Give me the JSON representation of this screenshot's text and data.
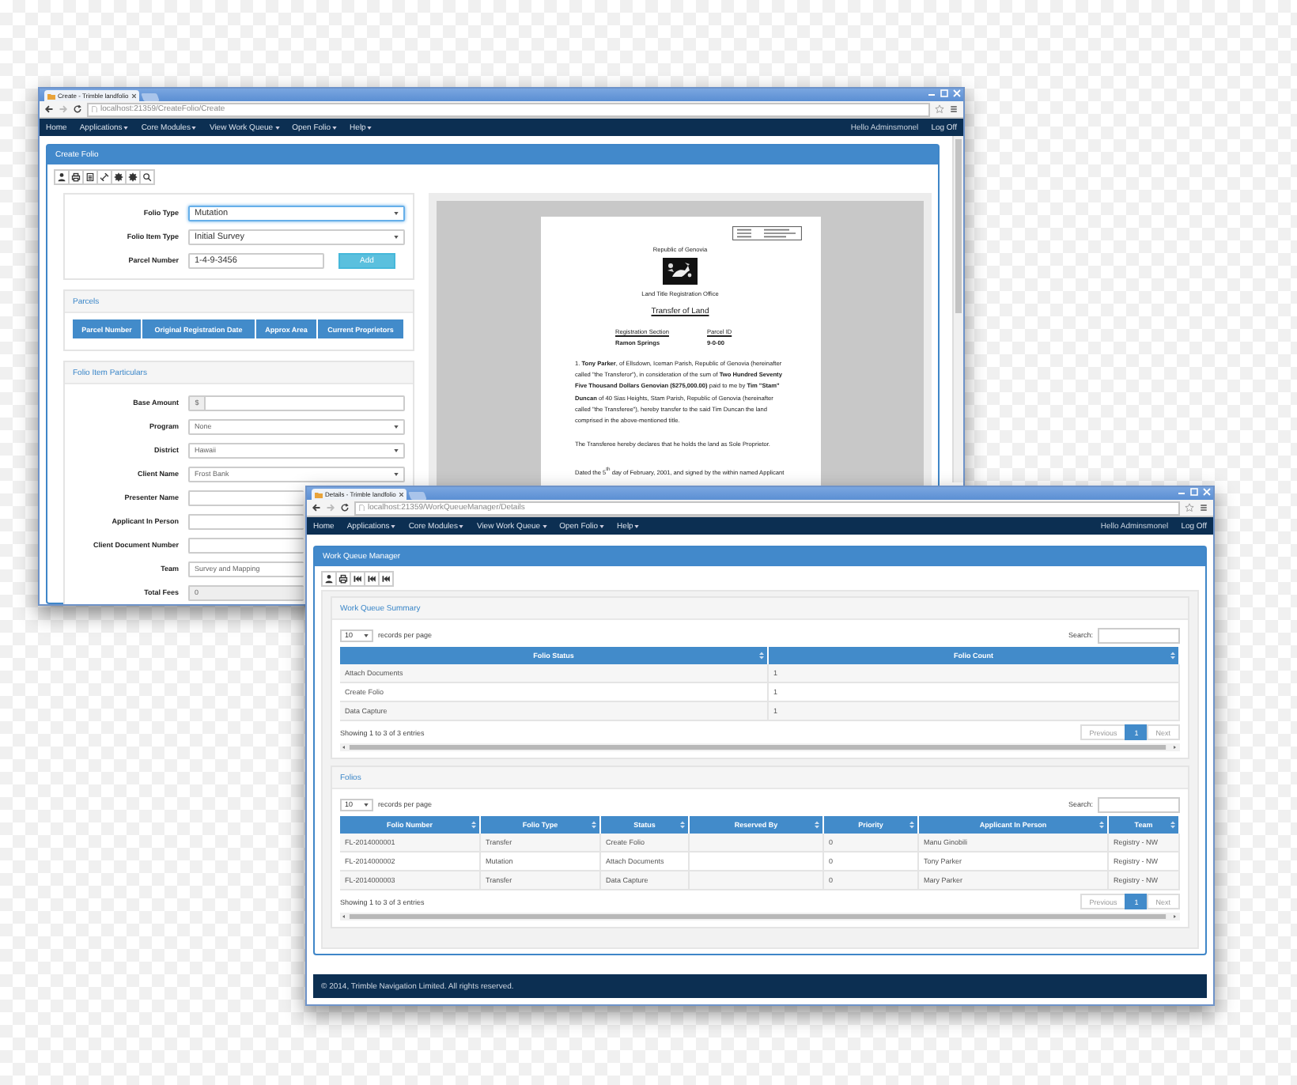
{
  "create_window": {
    "tab_title": "Create - Trimble landfolio",
    "url": "localhost:21359/CreateFolio/Create",
    "nav": [
      {
        "label": "Home",
        "dropdown": false
      },
      {
        "label": "Applications",
        "dropdown": true
      },
      {
        "label": "Core Modules",
        "dropdown": true
      },
      {
        "label": "View Work Queue",
        "dropdown": true
      },
      {
        "label": "Open Folio",
        "dropdown": true
      },
      {
        "label": "Help",
        "dropdown": true
      }
    ],
    "greeting": "Hello Adminsmonel",
    "logoff": "Log Off",
    "panel_title": "Create Folio",
    "folio_fields": [
      {
        "label": "Folio Type",
        "kind": "select",
        "value": "Mutation",
        "focused": true
      },
      {
        "label": "Folio Item Type",
        "kind": "select",
        "value": "Initial Survey",
        "focused": false
      },
      {
        "label": "Parcel Number",
        "kind": "text",
        "value": "1-4-9-3456",
        "focused": false
      }
    ],
    "add_button": "Add",
    "parcels": {
      "title": "Parcels",
      "columns": [
        "Parcel Number",
        "Original Registration Date",
        "Approx Area",
        "Current Proprietors"
      ]
    },
    "particulars": {
      "title": "Folio Item Particulars",
      "fields": [
        {
          "label": "Base Amount",
          "kind": "addon",
          "addon": "$"
        },
        {
          "label": "Program",
          "kind": "select",
          "value": "None"
        },
        {
          "label": "District",
          "kind": "select",
          "value": "Hawaii"
        },
        {
          "label": "Client Name",
          "kind": "select",
          "value": "Frost Bank"
        },
        {
          "label": "Presenter Name",
          "kind": "text"
        },
        {
          "label": "Applicant In Person",
          "kind": "text"
        },
        {
          "label": "Client Document Number",
          "kind": "text"
        },
        {
          "label": "Team",
          "kind": "select",
          "value": "Survey and Mapping"
        },
        {
          "label": "Total Fees",
          "kind": "readonly",
          "value": "0"
        }
      ]
    },
    "document": {
      "country": "Republic of Genovia",
      "office": "Land Title Registration Office",
      "title": "Transfer of Land",
      "parcel_labels": [
        "Registration Section",
        "Parcel ID"
      ],
      "parcel_values": [
        "Ramon Springs",
        "9-0-00"
      ],
      "paragraphs": [
        "1. **Tony Parker**, of Ellsdown, Iceman Parish, Republic of Genovia (hereinafter called \"the Transferor\"), in consideration of the sum of **Two Hundred Seventy Five Thousand Dollars Genovian ($275,000.00)** paid to me by **Tim \"Stam\" Duncan** of 40 Sias Heights, Stam Parish, Republic of Genovia (hereinafter called \"the Transferee\"), hereby transfer to the said Tim Duncan the land comprised in the above-mentioned title.",
        "The Transferee hereby declares that he holds the land as Sole Proprietor.",
        "Dated the 5$^{th}$ day of February, 2001, and signed by the within named Applicant"
      ]
    }
  },
  "details_window": {
    "tab_title": "Details - Trimble landfolio",
    "url": "localhost:21359/WorkQueueManager/Details",
    "nav": [
      {
        "label": "Home",
        "dropdown": false
      },
      {
        "label": "Applications",
        "dropdown": true
      },
      {
        "label": "Core Modules",
        "dropdown": true
      },
      {
        "label": "View Work Queue",
        "dropdown": true
      },
      {
        "label": "Open Folio",
        "dropdown": true
      },
      {
        "label": "Help",
        "dropdown": true
      }
    ],
    "greeting": "Hello Adminsmonel",
    "logoff": "Log Off",
    "panel_title": "Work Queue Manager",
    "tables": [
      {
        "title": "Work Queue Summary",
        "page_size": "10",
        "page_size_label": "records per page",
        "search_label": "Search:",
        "columns": [
          "Folio Status",
          "Folio Count"
        ],
        "rows": [
          [
            "Attach Documents",
            "1"
          ],
          [
            "Create Folio",
            "1"
          ],
          [
            "Data Capture",
            "1"
          ]
        ],
        "info": "Showing 1 to 3 of 3 entries",
        "pages": [
          {
            "label": "Previous",
            "selected": false
          },
          {
            "label": "1",
            "selected": true
          },
          {
            "label": "Next",
            "selected": false
          }
        ]
      },
      {
        "title": "Folios",
        "page_size": "10",
        "page_size_label": "records per page",
        "search_label": "Search:",
        "columns": [
          "Folio Number",
          "Folio Type",
          "Status",
          "Reserved By",
          "Priority",
          "Applicant In Person",
          "Team"
        ],
        "rows": [
          [
            "FL-2014000001",
            "Transfer",
            "Create Folio",
            null,
            "0",
            "Manu Ginobili",
            "Registry - NW"
          ],
          [
            "FL-2014000002",
            "Mutation",
            "Attach Documents",
            null,
            "0",
            "Tony Parker",
            "Registry - NW"
          ],
          [
            "FL-2014000003",
            "Transfer",
            "Data Capture",
            null,
            "0",
            "Mary Parker",
            "Registry - NW"
          ]
        ],
        "info": "Showing 1 to 3 of 3 entries",
        "pages": [
          {
            "label": "Previous",
            "selected": false
          },
          {
            "label": "1",
            "selected": true
          },
          {
            "label": "Next",
            "selected": false
          }
        ]
      }
    ],
    "footer": "© 2014, Trimble Navigation Limited. All rights reserved."
  }
}
